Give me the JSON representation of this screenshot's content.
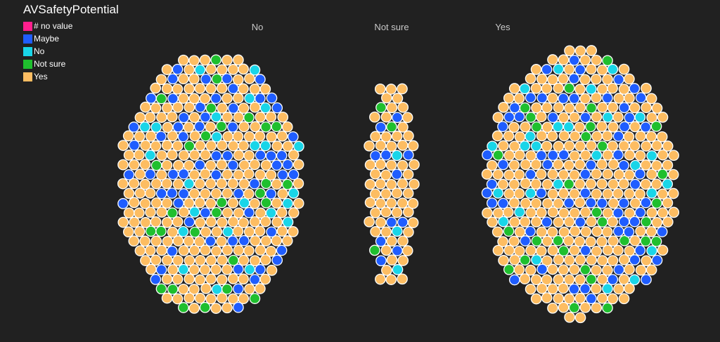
{
  "legend": {
    "title": "AVSafetyPotential",
    "items": [
      {
        "label": "# no value",
        "color": "#ff1f8e"
      },
      {
        "label": "Maybe",
        "color": "#1f5dff"
      },
      {
        "label": "No",
        "color": "#19d5e8"
      },
      {
        "label": "Not sure",
        "color": "#1fbf2e"
      },
      {
        "label": "Yes",
        "color": "#fdbd62"
      }
    ]
  },
  "groups": [
    {
      "label": "No"
    },
    {
      "label": "Not sure"
    },
    {
      "label": "Yes"
    }
  ],
  "chart_data": {
    "type": "scatter",
    "description_type": "beeswarm",
    "color_field": "AVSafetyPotential",
    "x_field": "AVSafetyPotential",
    "categories": [
      "No",
      "Not sure",
      "Yes"
    ],
    "series": [
      {
        "name": "Maybe",
        "values": [
          65,
          14,
          70
        ]
      },
      {
        "name": "No",
        "values": [
          24,
          4,
          26
        ]
      },
      {
        "name": "Not sure",
        "values": [
          28,
          4,
          30
        ]
      },
      {
        "name": "Yes",
        "values": [
          243,
          72,
          264
        ]
      }
    ]
  }
}
